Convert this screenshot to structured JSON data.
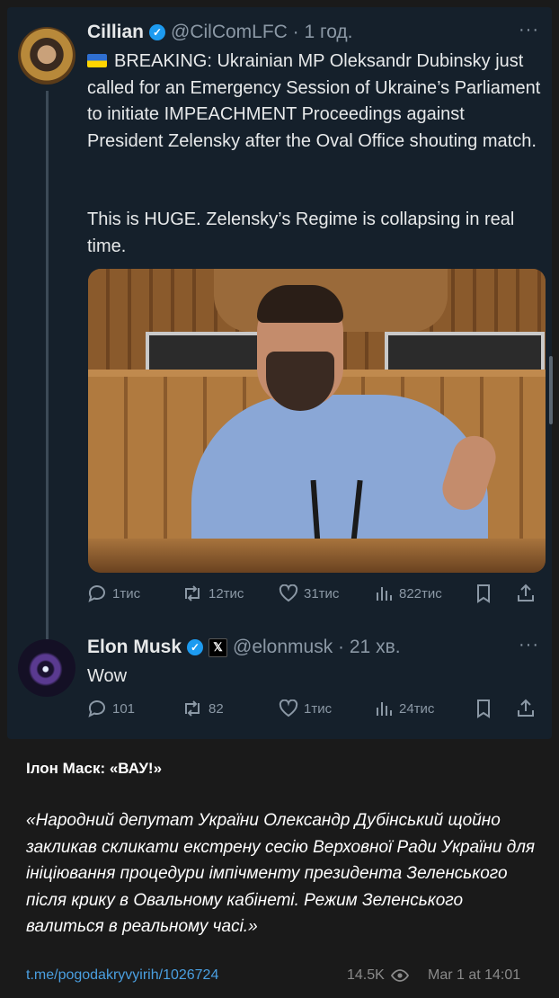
{
  "tweet1": {
    "name": "Cillian",
    "handle_time": "@CilComLFC · 1 год.",
    "text_p1": "BREAKING: Ukrainian MP Oleksandr Dubinsky just called for an Emergency Session of Ukraine’s Parliament to initiate IMPEACHMENT Proceedings against President Zelensky after the Oval Office shouting match.",
    "text_p2": "This is HUGE. Zelensky’s Regime is collapsing in real time.",
    "replies": "1тис",
    "reposts": "12тис",
    "likes": "31тис",
    "views": "822тис"
  },
  "tweet2": {
    "name": "Elon Musk",
    "x_badge": "𝕏",
    "handle_time": "@elonmusk · 21 хв.",
    "text": "Wow",
    "replies": "101",
    "reposts": "82",
    "likes": "1тис",
    "views": "24тис"
  },
  "caption": {
    "title": "Ілон Маск: «ВАУ!»",
    "quote": "«Народний депутат України Олександр Дубінський щойно закликав скликати екстрену сесію Верховної Ради України для ініціювання процедури імпічменту президента Зеленського після крику в Овальному кабінеті. Режим Зеленського валиться в реальному часі.»",
    "link": "t.me/pogodakryvyirih/1026724",
    "views": "14.5K",
    "time": "Mar 1 at 14:01"
  },
  "colors": {
    "tweet_bg": "#15202b",
    "text": "#e7e9ea",
    "muted": "#8b98a5",
    "verified": "#1d9bf0",
    "link": "#4a9fe0"
  },
  "icons": [
    "verified-badge-icon",
    "more-icon",
    "reply-icon",
    "repost-icon",
    "like-icon",
    "views-icon",
    "bookmark-icon",
    "share-icon",
    "eye-icon"
  ]
}
